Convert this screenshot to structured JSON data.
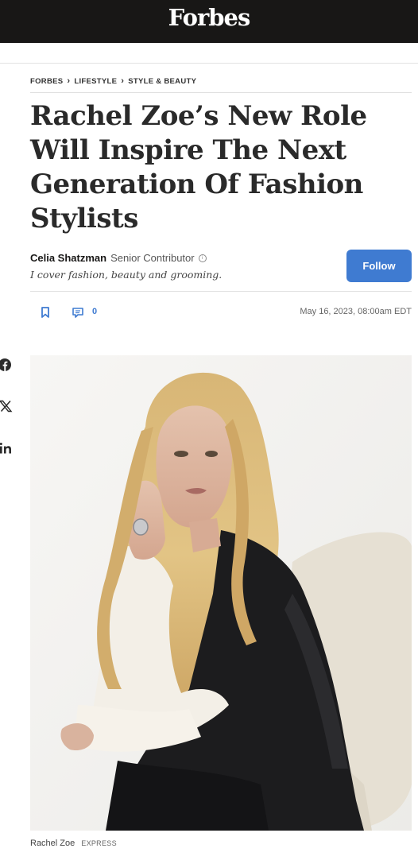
{
  "header": {
    "logo": "Forbes"
  },
  "breadcrumb": {
    "items": [
      "FORBES",
      "LIFESTYLE",
      "STYLE & BEAUTY"
    ]
  },
  "article": {
    "title": "Rachel Zoe’s New Role Will Inspire The Next Generation Of Fashion Stylists",
    "author": {
      "name": "Celia Shatzman",
      "role": "Senior Contributor",
      "bio": "I cover fashion, beauty and grooming.",
      "follow_label": "Follow"
    },
    "comment_count": "0",
    "date": "May 16, 2023, 08:00am EDT",
    "image": {
      "caption": "Rachel Zoe",
      "credit": "EXPRESS"
    }
  },
  "share": {
    "icons": [
      "facebook-icon",
      "x-icon",
      "linkedin-icon"
    ]
  },
  "colors": {
    "header_bg": "#181716",
    "accent": "#3f7bd1"
  }
}
